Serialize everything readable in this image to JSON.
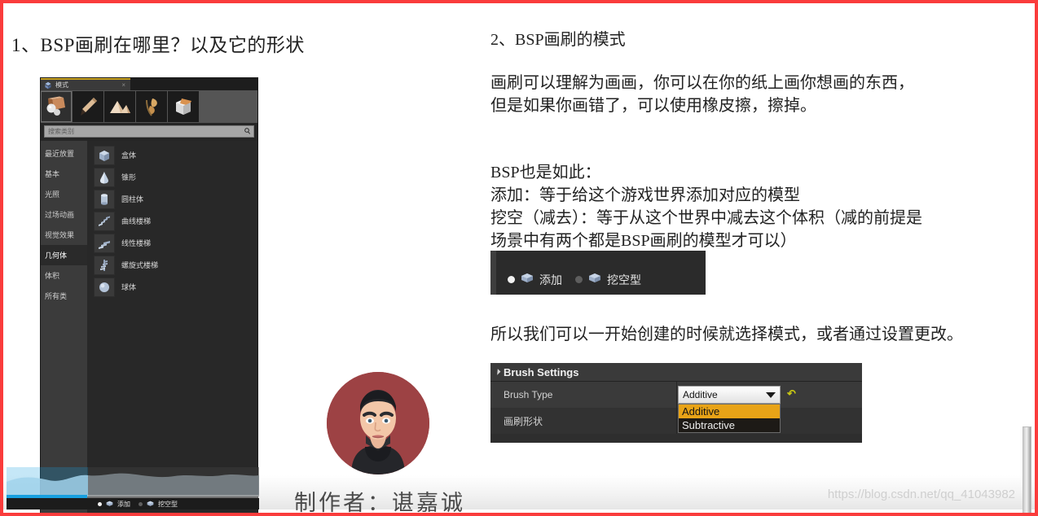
{
  "slide": {
    "heading_left": "1、BSP画刷在哪里？以及它的形状",
    "heading_right": "2、BSP画刷的模式",
    "paragraph_1_line_1": "画刷可以理解为画画，你可以在你的纸上画你想画的东西，",
    "paragraph_1_line_2": "但是如果你画错了，可以使用橡皮擦，擦掉。",
    "paragraph_2_line_1": "BSP也是如此：",
    "paragraph_2_line_2": "添加：等于给这个游戏世界添加对应的模型",
    "paragraph_2_line_3": "挖空（减去）：等于从这个世界中减去这个体积（减的前提是",
    "paragraph_2_line_4": "场景中有两个都是BSP画刷的模型才可以）",
    "paragraph_3": "所以我们可以一开始创建的时候就选择模式，或者通过设置更改。",
    "author_credit": "制作者：谌嘉诚",
    "watermark": "https://blog.csdn.net/qq_41043982",
    "border_color": "#fa3c3c"
  },
  "modes_panel": {
    "tab_label": "模式",
    "tab_close": "×",
    "toolbar": [
      {
        "name": "place-mode-icon",
        "title": "放置",
        "active": true
      },
      {
        "name": "paint-mode-icon",
        "title": "绘制",
        "active": false
      },
      {
        "name": "landscape-mode-icon",
        "title": "地形",
        "active": false
      },
      {
        "name": "foliage-mode-icon",
        "title": "植被",
        "active": false
      },
      {
        "name": "geometry-edit-mode-icon",
        "title": "几何体编辑",
        "active": false
      }
    ],
    "search_placeholder": "搜索类别",
    "search_icon": "search-icon",
    "categories": [
      {
        "label": "最近放置",
        "active": false
      },
      {
        "label": "基本",
        "active": false
      },
      {
        "label": "光照",
        "active": false
      },
      {
        "label": "过场动画",
        "active": false
      },
      {
        "label": "视觉效果",
        "active": false
      },
      {
        "label": "几何体",
        "active": true
      },
      {
        "label": "体积",
        "active": false
      },
      {
        "label": "所有类",
        "active": false
      }
    ],
    "items": [
      {
        "label": "盒体",
        "icon": "box-shape-icon"
      },
      {
        "label": "锥形",
        "icon": "cone-shape-icon"
      },
      {
        "label": "圆柱体",
        "icon": "cylinder-shape-icon"
      },
      {
        "label": "曲线楼梯",
        "icon": "curved-stair-icon"
      },
      {
        "label": "线性楼梯",
        "icon": "linear-stair-icon"
      },
      {
        "label": "螺旋式楼梯",
        "icon": "spiral-stair-icon"
      },
      {
        "label": "球体",
        "icon": "sphere-shape-icon"
      }
    ]
  },
  "brush_mode_widget": {
    "option_add": "添加",
    "option_subtract": "挖空型",
    "selected": "添加"
  },
  "brush_settings": {
    "panel_title": "Brush Settings",
    "rows": [
      {
        "label": "Brush Type"
      },
      {
        "label": "画刷形状"
      }
    ],
    "combo_value": "Additive",
    "combo_options": [
      {
        "label": "Additive",
        "selected": true
      },
      {
        "label": "Subtractive",
        "selected": false
      }
    ],
    "reset_icon": "reset-arrow-icon",
    "highlight_color": "#e8a317"
  },
  "video_overlay": {
    "progress_percent": "32",
    "progress_color": "#18a0e0",
    "mini_option_add": "添加",
    "mini_option_subtract": "挖空型"
  }
}
